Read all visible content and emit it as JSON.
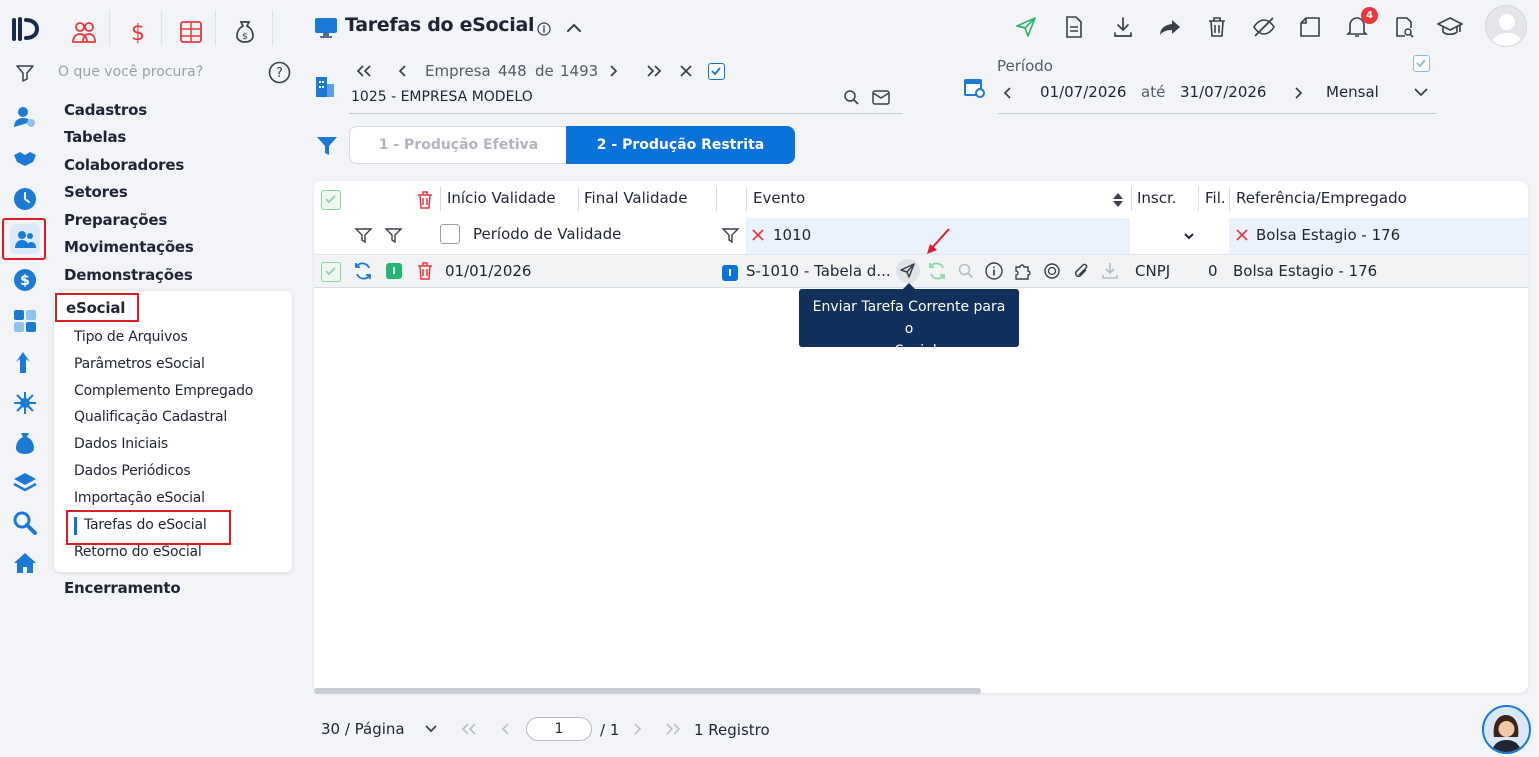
{
  "app": {
    "title": "Tarefas do eSocial"
  },
  "search": {
    "placeholder": "O que você procura?"
  },
  "menu": {
    "top_items": [
      "Cadastros",
      "Tabelas",
      "Colaboradores",
      "Setores",
      "Preparações",
      "Movimentações",
      "Demonstrações"
    ],
    "active_group": "eSocial",
    "sub_items": [
      "Tipo de Arquivos",
      "Parâmetros eSocial",
      "Complemento Empregado",
      "Qualificação Cadastral",
      "Dados Iniciais",
      "Dados Periódicos",
      "Importação eSocial",
      "Tarefas do eSocial",
      "Retorno do eSocial"
    ],
    "active_sub": "Tarefas do eSocial",
    "after": "Encerramento"
  },
  "company": {
    "label": "Empresa",
    "current": "448",
    "of": "de",
    "total": "1493",
    "name": "1025 - EMPRESA MODELO"
  },
  "period": {
    "label": "Período",
    "start": "01/07/2026",
    "until": "até",
    "end": "31/07/2026",
    "frequency": "Mensal"
  },
  "tabs": [
    {
      "label": "1 - Produção Efetiva",
      "active": false
    },
    {
      "label": "2 - Produção Restrita",
      "active": true
    }
  ],
  "toolbar": {
    "notification_count": "4"
  },
  "grid": {
    "columns": [
      "Início Validade",
      "Final Validade",
      "Evento",
      "Inscr.",
      "Fil.",
      "Referência/Empregado"
    ],
    "filters": {
      "validity": "Período de Validade",
      "evento": "1010",
      "referencia": "Bolsa Estagio - 176"
    },
    "rows": [
      {
        "inicio": "01/01/2026",
        "final": "",
        "evento_badge": "I",
        "status_badge": "I",
        "evento": "S-1010 - Tabela d...",
        "inscr": "CNPJ",
        "fil": "0",
        "referencia": "Bolsa Estagio - 176"
      }
    ]
  },
  "tooltip": {
    "line1": "Enviar Tarefa Corrente para o",
    "line2": "e-Social"
  },
  "footer": {
    "page_size": "30 / Página",
    "page_value": "1",
    "page_total": "/ 1",
    "records": "1 Registro"
  },
  "colors": {
    "accent": "#0a72d8",
    "highlight_red": "#e11b22",
    "tooltip_bg": "#10315c",
    "green_badge": "#22b573"
  }
}
